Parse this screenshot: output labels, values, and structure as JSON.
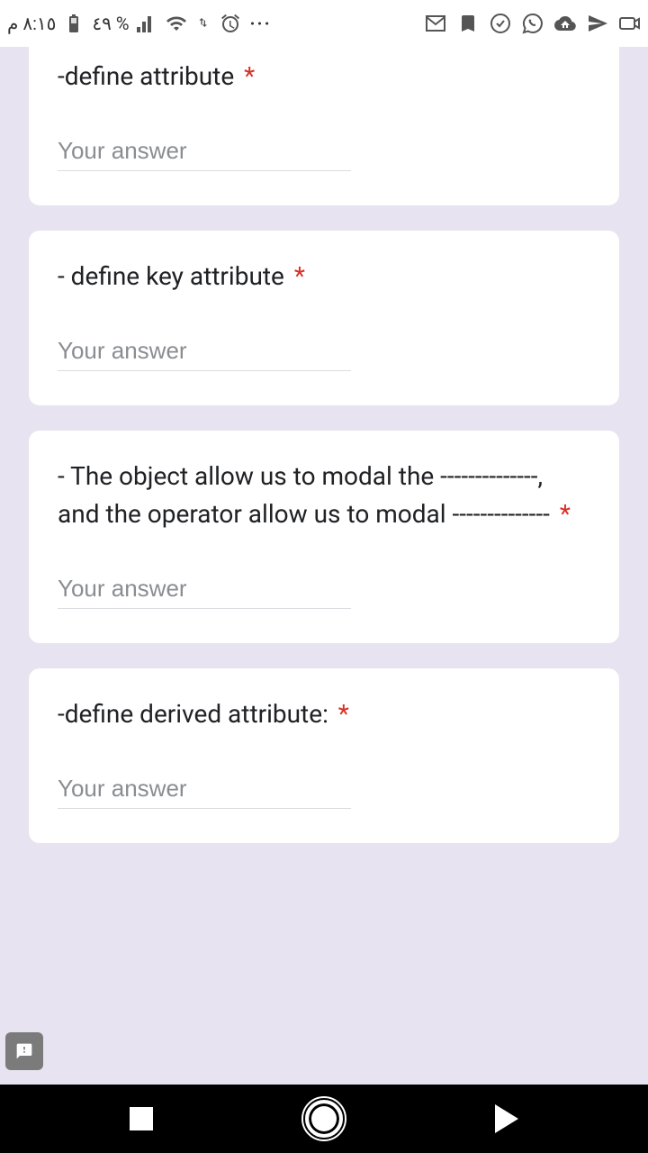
{
  "status": {
    "time": "٨:١٥ م",
    "battery_pct": "٤٩ %"
  },
  "form": {
    "placeholder": "Your answer",
    "required_mark": "*",
    "q1": {
      "text": "-define attribute "
    },
    "q2": {
      "text": "- define key attribute "
    },
    "q3": {
      "text": "- The object allow us to modal the --------------, and the operator allow us to modal -------------- "
    },
    "q4": {
      "text": "-define derived attribute: "
    }
  }
}
